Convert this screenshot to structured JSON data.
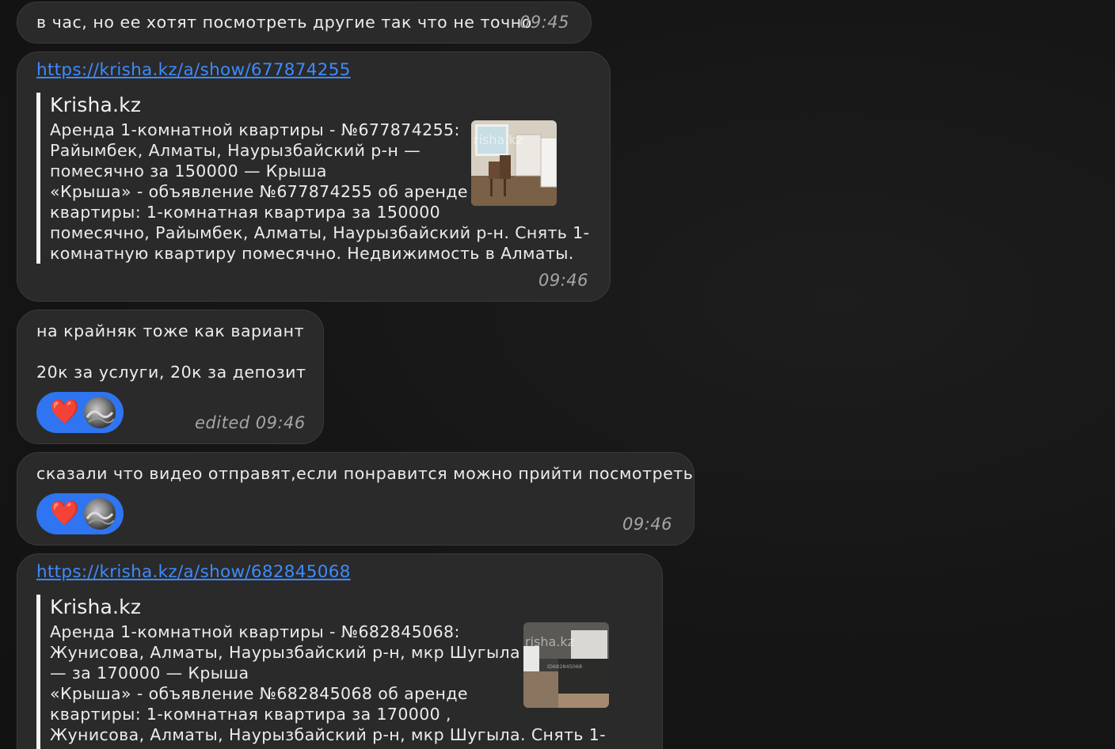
{
  "messages": {
    "m1": {
      "text": "в час, но ее хотят посмотреть другие так что не точно",
      "time": "09:45"
    },
    "m2": {
      "url": "https://krisha.kz/a/show/677874255",
      "site": "Krisha.kz",
      "title_lines": [
        "Аренда 1-комнатной квартиры - №677874255:",
        "Райымбек, Алматы, Наурызбайский р-н —",
        "помесячно за 150000 — Крыша"
      ],
      "desc_lines": [
        "«Крыша» - объявление №677874255 об аренде",
        "квартиры: 1-комнатная квартира за 150000",
        "помесячно, Райымбек, Алматы, Наурызбайский р-н. Снять 1-",
        "комнатную квартиру помесячно. Недвижимость в Алматы."
      ],
      "thumb_watermark": "risha.kz",
      "time": "09:46"
    },
    "m3": {
      "line1": "на крайняк тоже как вариант",
      "line2": "20к за услуги, 20к за депозит",
      "reaction": "❤️",
      "time": "edited 09:46"
    },
    "m4": {
      "text": "сказали что видео отправят,если понравится можно прийти посмотреть",
      "reaction": "❤️",
      "time": "09:46"
    },
    "m5": {
      "url": "https://krisha.kz/a/show/682845068",
      "site": "Krisha.kz",
      "title_lines": [
        "Аренда 1-комнатной квартиры - №682845068:",
        "Жунисова, Алматы, Наурызбайский р-н, мкр Шугыла",
        "— за 170000 — Крыша"
      ],
      "desc_lines": [
        "«Крыша» - объявление №682845068 об аренде",
        "квартиры: 1-комнатная квартира за 170000 ,",
        "Жунисова, Алматы, Наурызбайский р-н, мкр Шугыла. Снять 1-"
      ],
      "thumb_watermark": "risha.kz",
      "thumb_id": "ID682845068"
    }
  },
  "colors": {
    "bubble": "#2a2a2a",
    "link": "#3d8bff",
    "reaction_pill": "#2f74f0",
    "heart": "#e4202c"
  }
}
